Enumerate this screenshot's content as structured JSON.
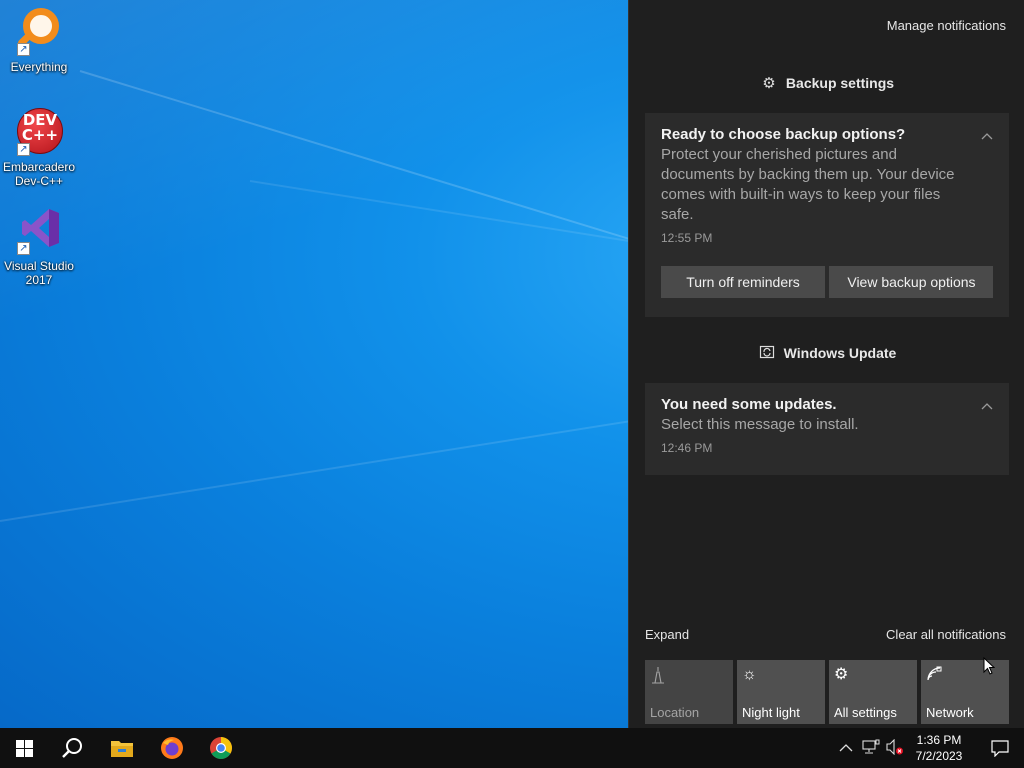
{
  "desktop": {
    "icons": [
      {
        "label": "Everything",
        "icon": "everything-icon"
      },
      {
        "label": "Embarcadero Dev-C++",
        "icon": "devcpp-icon",
        "badge": "DEV C++"
      },
      {
        "label": "Visual Studio 2017",
        "icon": "visual-studio-icon"
      }
    ]
  },
  "action_center": {
    "manage_notifications": "Manage notifications",
    "groups": [
      {
        "header": "Backup settings",
        "icon": "gear-icon",
        "toast": {
          "title": "Ready to choose backup options?",
          "body": "Protect your cherished pictures and documents by backing them up. Your device comes with built-in ways to keep your files safe.",
          "time": "12:55 PM",
          "buttons": [
            "Turn off reminders",
            "View backup options"
          ]
        }
      },
      {
        "header": "Windows Update",
        "icon": "windows-update-icon",
        "toast": {
          "title": "You need some updates.",
          "body": "Select this message to install.",
          "time": "12:46 PM"
        }
      }
    ],
    "expand": "Expand",
    "clear_all": "Clear all notifications",
    "quick_actions": [
      {
        "label": "Location",
        "icon": "location-icon",
        "enabled": false
      },
      {
        "label": "Night light",
        "icon": "night-light-icon",
        "enabled": true
      },
      {
        "label": "All settings",
        "icon": "gear-icon",
        "enabled": true
      },
      {
        "label": "Network",
        "icon": "network-icon",
        "enabled": true
      }
    ]
  },
  "taskbar": {
    "items": [
      "start-icon",
      "search-icon",
      "file-explorer-icon",
      "firefox-icon",
      "chrome-icon"
    ],
    "tray": [
      "chevron-up-icon",
      "network-tray-icon",
      "volume-muted-icon"
    ],
    "clock": {
      "time": "1:36 PM",
      "date": "7/2/2023"
    }
  }
}
